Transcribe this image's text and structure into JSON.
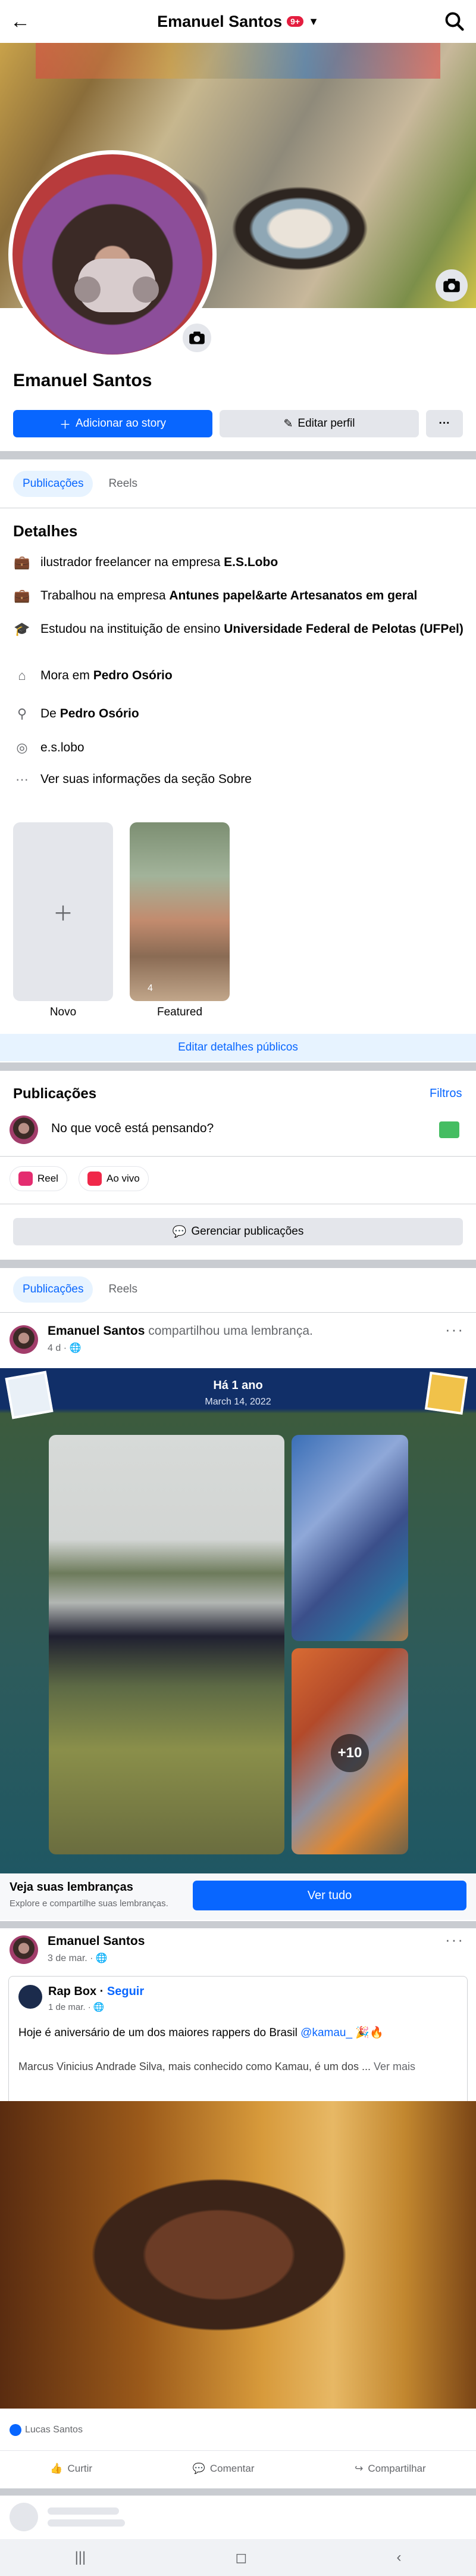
{
  "topbar": {
    "title": "Emanuel Santos",
    "badge": "9+"
  },
  "profile": {
    "name": "Emanuel Santos",
    "add_story": "Adicionar ao story",
    "edit_profile": "Editar perfil",
    "more": "···"
  },
  "tabs": [
    "Publicações",
    "Reels"
  ],
  "details": {
    "title": "Detalhes",
    "items": [
      {
        "pre": "ilustrador freelancer na empresa ",
        "bold": "E.S.Lobo"
      },
      {
        "pre": "Trabalhou na empresa ",
        "bold": "Antunes papel&arte Artesanatos em geral"
      },
      {
        "pre": "Estudou na instituição de ensino ",
        "bold": "Universidade Federal de Pelotas (UFPel)"
      },
      {
        "pre": "Mora em ",
        "bold": "Pedro Osório"
      },
      {
        "pre": "De ",
        "bold": "Pedro Osório"
      },
      {
        "pre": "e.s.lobo",
        "bold": ""
      },
      {
        "pre": "Ver suas informações da seção Sobre",
        "bold": ""
      }
    ]
  },
  "featured": {
    "new_label": "Novo",
    "featured_label": "Featured",
    "featured_count": "4",
    "edit_public": "Editar detalhes públicos"
  },
  "publications": {
    "title": "Publicações",
    "filters": "Filtros",
    "prompt": "No que você está pensando?",
    "reel": "Reel",
    "live": "Ao vivo",
    "manage": "Gerenciar publicações"
  },
  "post1": {
    "name": "Emanuel Santos",
    "action": " compartilhou uma lembrança.",
    "time": "4 d · ",
    "memory_header": "Há 1 ano",
    "memory_date": "March 14, 2022",
    "more_photos": "+10",
    "footer_title": "Veja suas lembranças",
    "footer_sub": "Explore e compartilhe suas lembranças.",
    "see_all": "Ver tudo"
  },
  "post2": {
    "name": "Emanuel Santos",
    "time": "3 de mar. · ",
    "shared_name": "Rap Box",
    "follow": "Seguir",
    "shared_time": "1 de mar. · ",
    "line1": "Hoje é aniversário de um dos maiores rappers do Brasil ",
    "mention": "@kamau_",
    "emoji": " 🎉🔥",
    "line2": "Marcus Vinicius Andrade Silva, mais conhecido como Kamau, é um dos ... ",
    "see_more": "Ver mais",
    "reactor": "Lucas Santos",
    "like": "Curtir",
    "comment": "Comentar",
    "share": "Compartilhar"
  },
  "colors": {
    "accent": "#0866ff",
    "separator": "#c9ccd1",
    "light_blue": "#e7f3ff"
  }
}
